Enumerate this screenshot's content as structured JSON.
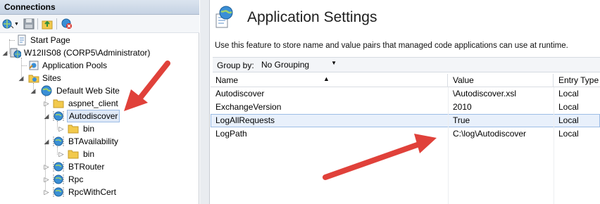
{
  "connections": {
    "header": "Connections",
    "toolbar": [
      "connect-icon",
      "save-icon",
      "up-icon",
      "disconnect-icon"
    ],
    "tree": [
      {
        "label": "Start Page",
        "icon": "start-page-icon",
        "level": 0
      },
      {
        "label": "W12IIS08 (CORP5\\Administrator)",
        "icon": "server-icon",
        "level": 0
      },
      {
        "label": "Application Pools",
        "icon": "app-pool-icon",
        "level": 1
      },
      {
        "label": "Sites",
        "icon": "sites-folder-icon",
        "level": 1
      },
      {
        "label": "Default Web Site",
        "icon": "globe-icon",
        "level": 2
      },
      {
        "label": "aspnet_client",
        "icon": "folder-icon",
        "level": 3
      },
      {
        "label": "Autodiscover",
        "icon": "web-app-icon",
        "level": 3,
        "selected": true
      },
      {
        "label": "bin",
        "icon": "folder-icon",
        "level": 4
      },
      {
        "label": "BTAvailability",
        "icon": "web-app-icon",
        "level": 3
      },
      {
        "label": "bin",
        "icon": "folder-icon",
        "level": 4
      },
      {
        "label": "BTRouter",
        "icon": "web-app-icon",
        "level": 3
      },
      {
        "label": "Rpc",
        "icon": "web-app-icon",
        "level": 3
      },
      {
        "label": "RpcWithCert",
        "icon": "web-app-icon",
        "level": 3
      }
    ]
  },
  "feature": {
    "title": "Application Settings",
    "description": "Use this feature to store name and value pairs that managed code applications can use at runtime.",
    "group_by_label": "Group by:",
    "group_by_value": "No Grouping",
    "columns": [
      "Name",
      "Value",
      "Entry Type"
    ],
    "rows": [
      {
        "name": "Autodiscover",
        "value": "\\Autodiscover.xsl",
        "type": "Local"
      },
      {
        "name": "ExchangeVersion",
        "value": "2010",
        "type": "Local"
      },
      {
        "name": "LogAllRequests",
        "value": "True",
        "type": "Local",
        "selected": true
      },
      {
        "name": "LogPath",
        "value": "C:\\log\\Autodiscover",
        "type": "Local"
      }
    ]
  },
  "colors": {
    "accent": "#e0413a",
    "selection": "#dfe9f7",
    "header": "#c5d2e3"
  }
}
